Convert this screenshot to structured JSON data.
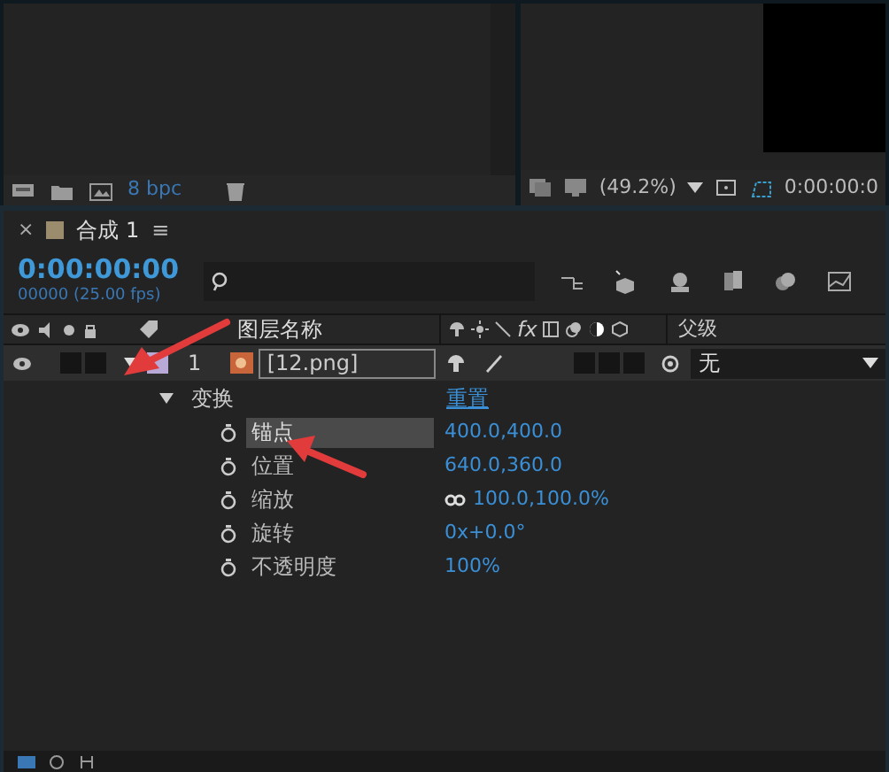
{
  "project_panel": {
    "bit_depth": "8 bpc"
  },
  "viewer": {
    "zoom": "(49.2%)",
    "timecode": "0:00:00:0"
  },
  "timeline": {
    "tab": {
      "close": "×",
      "title": "合成 1",
      "menu": "≡"
    },
    "timecode": "0:00:00:00",
    "frame_info": "00000 (25.00 fps)",
    "columns": {
      "layer_name": "图层名称",
      "fx": "fx",
      "parent": "父级"
    },
    "layers": [
      {
        "number": "1",
        "name": "[12.png]",
        "expanded": true,
        "parent": "无",
        "groups": [
          {
            "name": "变换",
            "expanded": true,
            "reset": "重置",
            "properties": [
              {
                "name": "锚点",
                "value": "400.0,400.0",
                "selected": true,
                "kind": "plain"
              },
              {
                "name": "位置",
                "value": "640.0,360.0",
                "selected": false,
                "kind": "plain"
              },
              {
                "name": "缩放",
                "value": "100.0,100.0%",
                "selected": false,
                "kind": "linked"
              },
              {
                "name": "旋转",
                "value": "0x+0.0°",
                "selected": false,
                "kind": "plain"
              },
              {
                "name": "不透明度",
                "value": "100%",
                "selected": false,
                "kind": "plain"
              }
            ]
          }
        ]
      }
    ]
  }
}
